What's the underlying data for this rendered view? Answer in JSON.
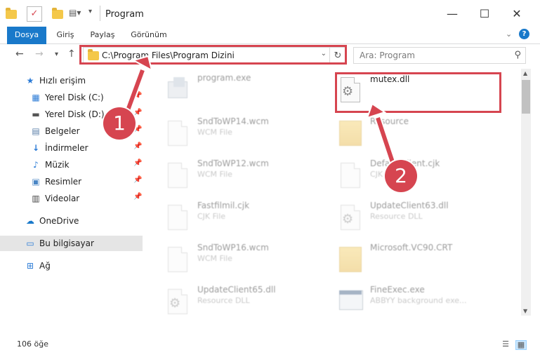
{
  "window": {
    "title": "Program",
    "minimize": "—",
    "maximize": "☐",
    "close": "✕"
  },
  "ribbon": {
    "tabs": [
      "Dosya",
      "Giriş",
      "Paylaş",
      "Görünüm"
    ],
    "expand": "⌄",
    "help": "?"
  },
  "address": {
    "path": "C:\\Program Files\\Program Dizini",
    "search_placeholder": "Ara: Program"
  },
  "sidebar": {
    "quick_access": "Hızlı erişim",
    "items": [
      {
        "label": "Yerel Disk (C:)",
        "icon": "drive-icon"
      },
      {
        "label": "Yerel Disk (D:)",
        "icon": "drive-icon"
      },
      {
        "label": "Belgeler",
        "icon": "documents-icon"
      },
      {
        "label": "İndirmeler",
        "icon": "download-icon"
      },
      {
        "label": "Müzik",
        "icon": "music-icon"
      },
      {
        "label": "Resimler",
        "icon": "pictures-icon"
      },
      {
        "label": "Videolar",
        "icon": "videos-icon"
      }
    ],
    "onedrive": "OneDrive",
    "this_pc": "Bu bilgisayar",
    "network": "Ağ"
  },
  "files": {
    "left": [
      {
        "name": "program.exe",
        "type": ""
      },
      {
        "name": "SndToWP14.wcm",
        "type": "WCM File"
      },
      {
        "name": "SndToWP12.wcm",
        "type": "WCM File"
      },
      {
        "name": "Fastfilmil.cjk",
        "type": "CJK File"
      },
      {
        "name": "SndToWP16.wcm",
        "type": "WCM File"
      },
      {
        "name": "UpdateClient65.dll",
        "type": "Resource DLL"
      }
    ],
    "right": [
      {
        "name": "mutex.dll",
        "type": ""
      },
      {
        "name": "Resource",
        "type": ""
      },
      {
        "name": "DefaultClient.cjk",
        "type": "CJK File"
      },
      {
        "name": "UpdateClient63.dll",
        "type": "Resource DLL"
      },
      {
        "name": "Microsoft.VC90.CRT",
        "type": ""
      },
      {
        "name": "FineExec.exe",
        "type": "ABBYY background exe..."
      }
    ]
  },
  "status": {
    "count": "106 öğe"
  },
  "callouts": {
    "one": "1",
    "two": "2"
  },
  "colors": {
    "accent": "#1979ca",
    "highlight": "#d64550"
  }
}
